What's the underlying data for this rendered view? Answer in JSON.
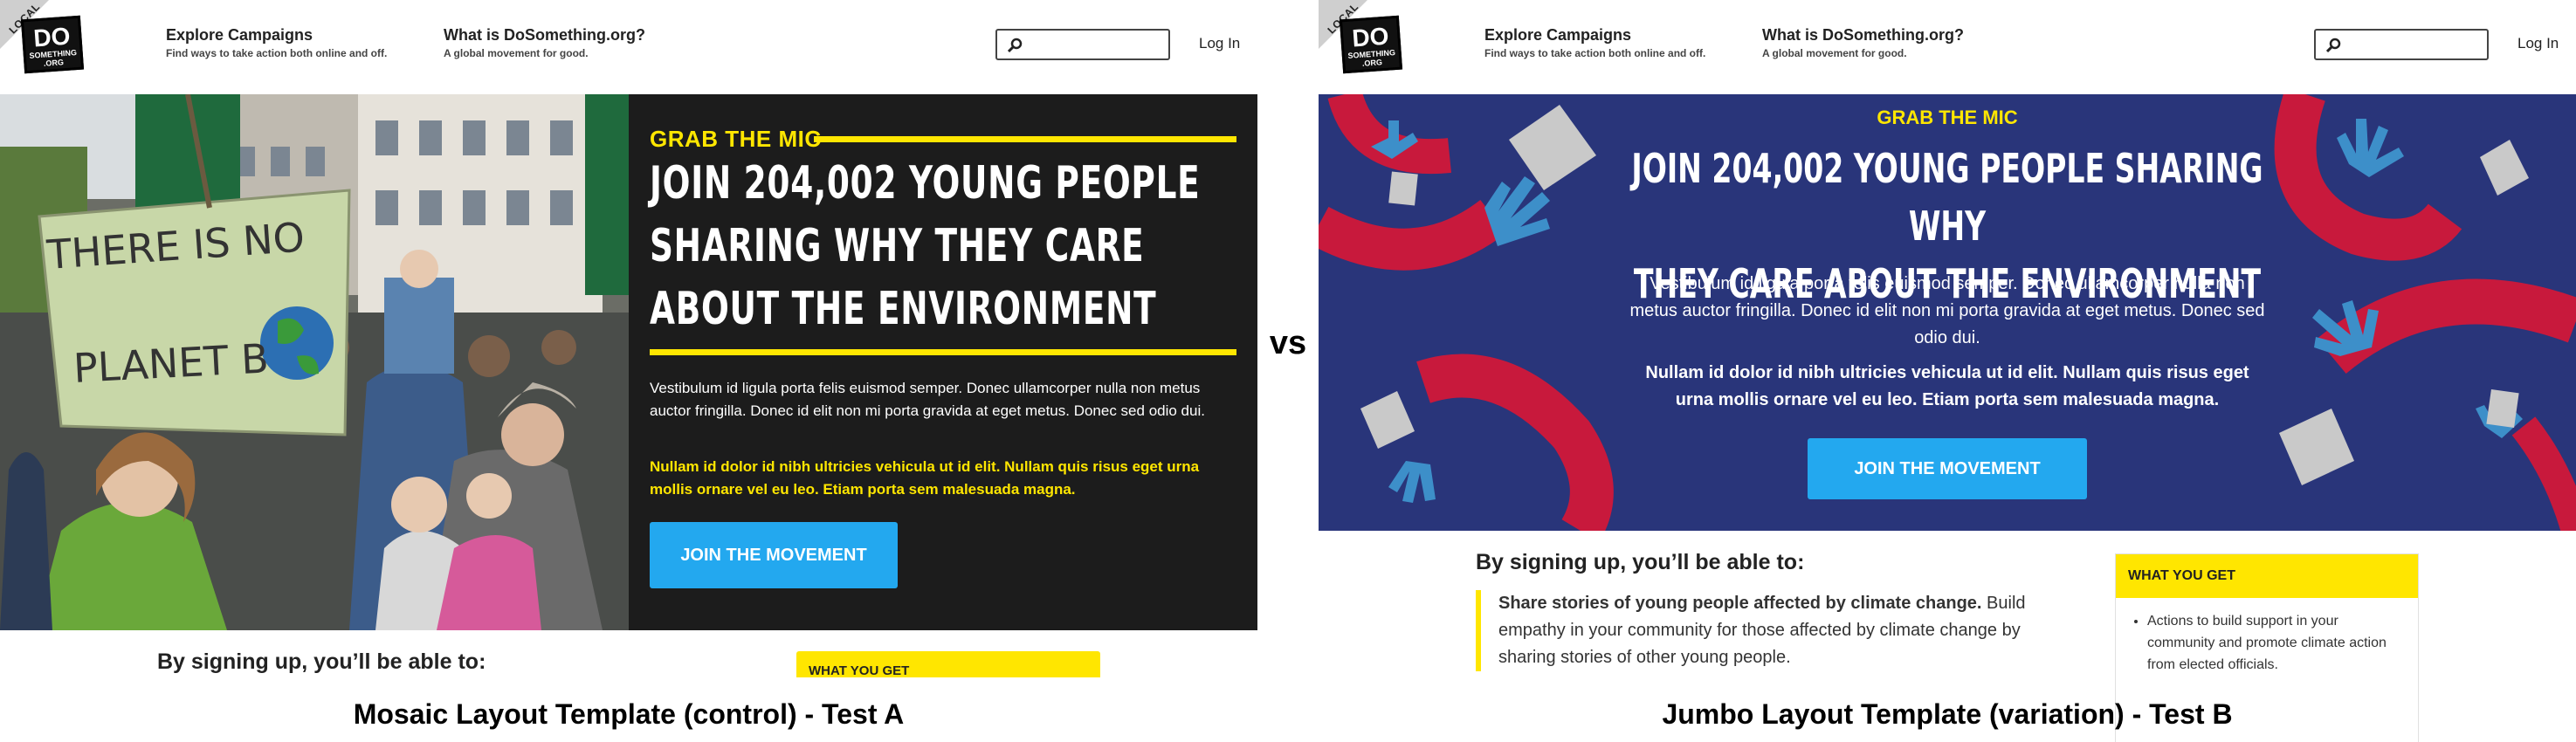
{
  "header": {
    "local_badge": "LOCAL",
    "logo_line1": "DO",
    "logo_line2": "SOMETHING",
    "logo_line3": ".ORG",
    "nav": [
      {
        "title": "Explore Campaigns",
        "subtitle": "Find ways to take action both online and off."
      },
      {
        "title": "What is DoSomething.org?",
        "subtitle": "A global movement for good."
      }
    ],
    "search_placeholder": "",
    "login_label": "Log In"
  },
  "test_a": {
    "kicker": "GRAB THE MIC",
    "headline_lines": [
      "JOIN 204,002 YOUNG PEOPLE",
      "SHARING WHY THEY CARE",
      "ABOUT THE ENVIRONMENT"
    ],
    "sign_text_1": "THERE IS NO",
    "sign_text_2": "PLANET B",
    "body": "Vestibulum id ligula porta felis euismod semper. Donec ullamcorper nulla non metus auctor fringilla. Donec id elit non mi porta gravida at eget metus. Donec sed odio dui.",
    "bold": "Nullam id dolor id nibh ultricies vehicula ut id elit. Nullam quis risus eget urna mollis ornare vel eu leo. Etiam porta sem malesuada magna.",
    "cta": "JOIN THE MOVEMENT",
    "signup_heading": "By signing up, you’ll be able to:",
    "what_you_get": "WHAT YOU GET",
    "caption": "Mosaic Layout Template (control) - Test A"
  },
  "vs": "vs",
  "test_b": {
    "kicker": "GRAB THE MIC",
    "headline_lines": [
      "JOIN 204,002 YOUNG PEOPLE SHARING WHY",
      "THEY CARE ABOUT THE ENVIRONMENT"
    ],
    "body": "Vestibulum id ligula porta felis euismod semper. Donec ullamcorper nulla non metus auctor fringilla. Donec id elit non mi porta gravida at eget metus. Donec sed odio dui.",
    "bold": "Nullam id dolor id nibh ultricies vehicula ut id elit. Nullam quis risus eget urna mollis ornare vel eu leo. Etiam porta sem malesuada magna.",
    "cta": "JOIN THE MOVEMENT",
    "signup_heading": "By signing up, you’ll be able to:",
    "share_bold": "Share stories of young people affected by climate change.",
    "share_rest": " Build empathy in your community for those affected by climate change by sharing stories of other young people.",
    "what_you_get": "WHAT YOU GET",
    "wyg_item": "Actions to build support in your community and promote climate action from elected officials.",
    "caption": "Jumbo Layout Template (variation) - Test B"
  },
  "colors": {
    "accent_yellow": "#ffe600",
    "cta_blue": "#23a8ef",
    "hero_dark": "#1c1c1c",
    "hero_navy": "#29357a",
    "hand_red": "#c8193c",
    "hand_blue": "#3d8fc9"
  }
}
